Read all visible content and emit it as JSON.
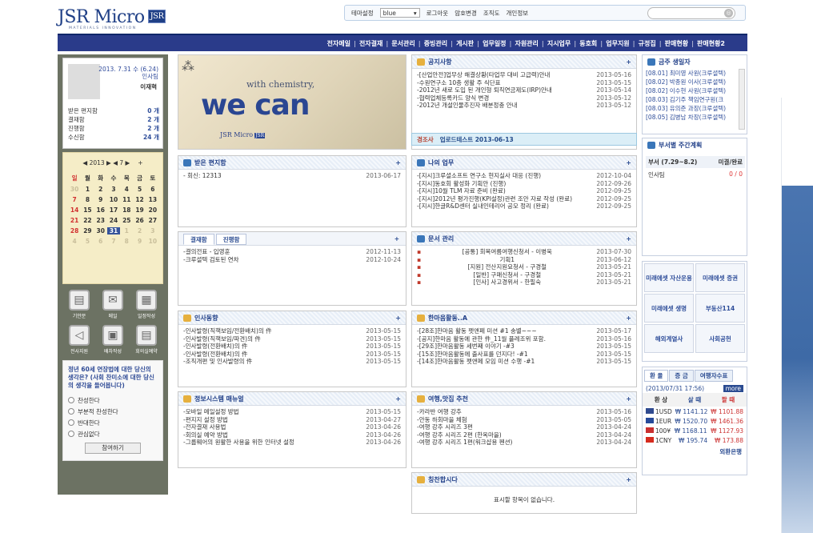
{
  "brand": {
    "logo": "JSR Micro",
    "logo_badge": "JSR",
    "tagline": "MATERIALS INNOVATION"
  },
  "topbar": {
    "theme_label": "테마설정",
    "theme_value": "blue",
    "logout": "로그아웃",
    "password": "암호변경",
    "org": "조직도",
    "profile": "개인정보",
    "search_placeholder": ""
  },
  "nav": [
    "전자메일",
    "전자결재",
    "문서관리",
    "증빙관리",
    "게시판",
    "업무일정",
    "자원관리",
    "지시업무",
    "동호회",
    "업무지원",
    "규정집",
    "판매현황",
    "판매현황2"
  ],
  "profile": {
    "date": "2013. 7.31 수 (6.24)",
    "dept": "인사팀",
    "name": "이재혁",
    "mail_items": [
      {
        "label": "받은 편지함",
        "count": "0 개"
      },
      {
        "label": "결재함",
        "count": "2 개"
      },
      {
        "label": "진행함",
        "count": "2 개"
      },
      {
        "label": "수신함",
        "count": "24 개"
      }
    ]
  },
  "calendar": {
    "header": "◀ 2013 ▶ ◀ 7 ▶",
    "plus": "+",
    "days": [
      "일",
      "월",
      "화",
      "수",
      "목",
      "금",
      "토"
    ],
    "cells": [
      "30",
      "1",
      "2",
      "3",
      "4",
      "5",
      "6",
      "7",
      "8",
      "9",
      "10",
      "11",
      "12",
      "13",
      "14",
      "15",
      "16",
      "17",
      "18",
      "19",
      "20",
      "21",
      "22",
      "23",
      "24",
      "25",
      "26",
      "27",
      "28",
      "29",
      "30",
      "31",
      "1",
      "2",
      "3",
      "4",
      "5",
      "6",
      "7",
      "8",
      "9",
      "10"
    ]
  },
  "quick": [
    {
      "label": "기안문",
      "icon": "document-icon"
    },
    {
      "label": "메일",
      "icon": "mail-icon"
    },
    {
      "label": "일정작성",
      "icon": "calendar-icon"
    },
    {
      "label": "전사지원",
      "icon": "share-icon"
    },
    {
      "label": "배차작성",
      "icon": "bus-icon"
    },
    {
      "label": "회의실예약",
      "icon": "room-icon"
    }
  ],
  "poll": {
    "question": "정년 60세 연장법에 대한 당신의 생각은? (사회 찬미소에 대한 당신의 생각을 들어봅니다)",
    "options": [
      "찬성한다",
      "부분적 찬성한다",
      "반대한다",
      "관심없다"
    ],
    "button": "참여하기"
  },
  "hero": {
    "line1": "with chemistry,",
    "line2": "we can",
    "brand": "JSR Micro",
    "badge": "JSR"
  },
  "notice": {
    "title": "공지사항",
    "more": "+",
    "rows": [
      {
        "t": "-[산업안전]업무상 해결상황(타업무 대비 고급력)안내",
        "d": "2013-05-16"
      },
      {
        "t": "-수원연구소 10층 생활 주 식단표",
        "d": "2013-05-15"
      },
      {
        "t": "-2012년 새로 도입 된 개인형 퇴직연금제도(IRP)안내",
        "d": "2013-05-14"
      },
      {
        "t": "-협력업체등록카드 양식 변경",
        "d": "2013-05-12"
      },
      {
        "t": "-2012년 개설인물추진자 배분정충 안내",
        "d": "2013-05-12"
      }
    ],
    "banner_label": "경조사",
    "banner_text": "업로드테스트 2013-06-13"
  },
  "received": {
    "title": "받은 편지함",
    "more": "+",
    "rows": [
      {
        "t": "- 회신: 12313",
        "d": "2013-06-17"
      }
    ]
  },
  "mywork": {
    "title": "나의 업무",
    "more": "+",
    "rows": [
      {
        "t": "-[지시]크루셜소프트 연구소 현지실사 대응 (진행)",
        "d": "2012-10-04"
      },
      {
        "t": "-[지시]동호회 활성화 기획안 (진행)",
        "d": "2012-09-26"
      },
      {
        "t": "-[지시]10월 TLM 자료 준비 (완료)",
        "d": "2012-09-25"
      },
      {
        "t": "-[지시]2012년 평가진행(KPI설정)관련 조안 자료 작성 (완료)",
        "d": "2012-09-25"
      },
      {
        "t": "-[지시]한글R&D센터 실내인테리어 공모 정리 (완료)",
        "d": "2012-09-25"
      }
    ]
  },
  "approval": {
    "tab1": "결재함",
    "tab2": "진행함",
    "more": "+",
    "rows": [
      {
        "t": "-결의전표 - 입영훈",
        "d": "2012-11-13"
      },
      {
        "t": "-크루셜텍 검토된 연차",
        "d": "2012-10-24"
      }
    ]
  },
  "docs": {
    "title": "문서 관리",
    "more": "+",
    "rows": [
      {
        "t": "[공통] 회복여름여행신청서 - 이병욱",
        "d": "2013-07-30"
      },
      {
        "t": "기획1",
        "d": "2013-06-12"
      },
      {
        "t": "[지원] 전산지원요청서 - 구경철",
        "d": "2013-05-21"
      },
      {
        "t": "[일반] 구매신청서 - 구경철",
        "d": "2013-05-21"
      },
      {
        "t": "[인사] 사고경위서 - 한필숙",
        "d": "2013-05-21"
      }
    ]
  },
  "hr": {
    "title": "인사동향",
    "more": "+",
    "rows": [
      {
        "t": "-인사발령(직책보임/전환배치)의 件",
        "d": "2013-05-15"
      },
      {
        "t": "-인사발령(직책보임/파견)의 件",
        "d": "2013-05-15"
      },
      {
        "t": "-인사발령(전환배치)의 件",
        "d": "2013-05-15"
      },
      {
        "t": "-인사발령(전환배치)의 件",
        "d": "2013-05-15"
      },
      {
        "t": "-조직개편 및 인사발령의 件",
        "d": "2013-05-15"
      }
    ]
  },
  "club": {
    "title": "한마음활동..A",
    "more": "+",
    "rows": [
      {
        "t": "-[28조]한마음 활동 펫앤페 미션 #1 송별~~~",
        "d": "2013-05-17"
      },
      {
        "t": "-[공지]한마음 활동에 관한 件_11월 플레조위 포함.",
        "d": "2013-05-16"
      },
      {
        "t": "-[29조]한마음활동 세번째 이야기 -#3",
        "d": "2013-05-15"
      },
      {
        "t": "-[15조]한마음활동에 출사표를 던지다! -#1",
        "d": "2013-05-15"
      },
      {
        "t": "-[14조]한마음활동 펫앤페 모임 미션 수행 -#1",
        "d": "2013-05-15"
      }
    ]
  },
  "it": {
    "title": "정보시스템 매뉴얼",
    "more": "+",
    "rows": [
      {
        "t": "-모바일 메일설정 방법",
        "d": "2013-05-15"
      },
      {
        "t": "-편지지 설정 방법",
        "d": "2013-04-27"
      },
      {
        "t": "-전자결재 사용법",
        "d": "2013-04-26"
      },
      {
        "t": "-회의실 예약 방법",
        "d": "2013-04-26"
      },
      {
        "t": "-그룹웨어의 원활한 사용을 위한 인터넷 설정",
        "d": "2013-04-26"
      }
    ]
  },
  "travel": {
    "title": "여행,맛집 추천",
    "more": "+",
    "rows": [
      {
        "t": "-카라반 여행 강추",
        "d": "2013-05-16"
      },
      {
        "t": "-안동 하회마을 체험",
        "d": "2013-05-05"
      },
      {
        "t": "-여행 강추 시리즈 3편",
        "d": "2013-04-24"
      },
      {
        "t": "-여행 강추 시리즈 2편 (한옥마을)",
        "d": "2013-04-24"
      },
      {
        "t": "-여행 강추 시리즈 1편(워크샵용 펜션)",
        "d": "2013-04-24"
      }
    ]
  },
  "praise": {
    "title": "칭찬합시다",
    "more": "+",
    "empty": "표시할 항목이 없습니다."
  },
  "people": {
    "title": "금주 생일자",
    "rows": [
      "[08.01] 최미영 사원(크루셜텍)",
      "[08.02] 박종원 이사(크루셜텍)",
      "[08.02] 이수현 사원(크루셜텍)",
      "[08.03] 김기주 책임연구원(크",
      "[08.03] 유의준 과장(크루셜텍)",
      "[08.05] 김병남 차장(크루셜텍)"
    ]
  },
  "weekly": {
    "title": "부서별 주간계획",
    "col1": "부서 (7.29~8.2)",
    "col2": "미결/완료",
    "dept": "인사팀",
    "val": "0 / 0"
  },
  "links": [
    "미래에셋 자산운용",
    "미래에셋 증권",
    "미래에셋 생명",
    "부동산114",
    "해외계열사",
    "사회공헌"
  ],
  "exchange": {
    "tab1": "환 율",
    "tab2": "증 금",
    "tab3": "여행자수표",
    "stamp": "(2013/07/31 17:56)",
    "more": "more",
    "h1": "환 상",
    "h2": "살 때",
    "h3": "팔 때",
    "rows": [
      {
        "cur": "1USD",
        "buy": "₩ 1141.12",
        "sell": "₩ 1101.88"
      },
      {
        "cur": "1EUR",
        "buy": "₩ 1520.70",
        "sell": "₩ 1461.36"
      },
      {
        "cur": "100¥",
        "buy": "₩ 1168.11",
        "sell": "₩ 1127.93"
      },
      {
        "cur": "1CNY",
        "buy": "₩ 195.74",
        "sell": "₩ 173.88"
      }
    ],
    "footer": "외환은행"
  }
}
